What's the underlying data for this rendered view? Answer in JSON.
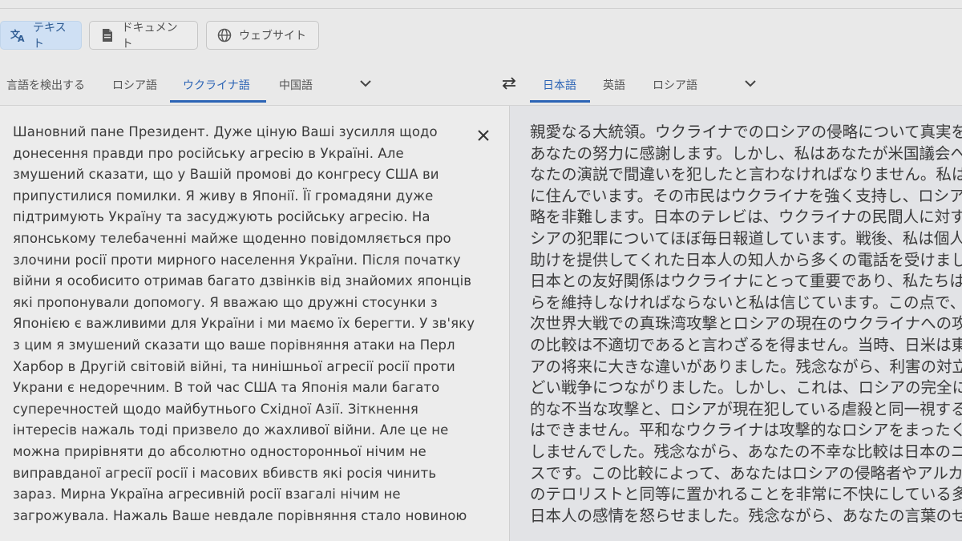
{
  "modes": [
    {
      "label": "テキスト",
      "icon": "translate-icon",
      "active": true
    },
    {
      "label": "ドキュメント",
      "icon": "document-icon",
      "active": false
    },
    {
      "label": "ウェブサイト",
      "icon": "globe-icon",
      "active": false
    }
  ],
  "source_langs": {
    "detect": "言語を検出する",
    "items": [
      "ロシア語",
      "ウクライナ語",
      "中国語"
    ],
    "active": "ウクライナ語"
  },
  "target_langs": {
    "items": [
      "日本語",
      "英語",
      "ロシア語"
    ],
    "active": "日本語"
  },
  "source_text": [
    "Шановний пане Президент. Дуже ціную Ваші зусилля щодо",
    "донесення правди про російську агресію в Україні. Але",
    "змушений сказати, що у Вашій промові до конгресу США ви",
    "припустилися помилки. Я живу в Японії. Її громадяни дуже",
    "підтримують Україну та засуджують російську агресію. На",
    "японському телебаченні майже щоденно повідомляється про",
    "злочини росії проти мирного населення України. Після початку",
    "війни я особисито отримав багато дзвінків від знайомих японців",
    "які пропонували допомогу. Я вважаю що дружні стосунки з",
    "Японією є важливими для України і ми маємо їх берегти. У зв'яку",
    "з цим я змушений сказати що ваше порівняння атаки на Перл",
    "Харбор в Другій світовій війні, та нинішньої агресії росії проти",
    "Украни є недоречним.  В той час США та Японія мали багато",
    "суперечностей щодо майбутнього Східної Азії. Зіткнення",
    "інтересів нажаль тоді призвело до жахливої війни. Але це не",
    "можна прирівняти до абсолютно односторонньої нічим не",
    "виправданої агресії росії і масових вбивств які росія чинить",
    "зараз. Мирна Україна агресивній росії взагалі нічим не",
    "загрожувала. Нажаль Ваше невдале порівняння стало новиною"
  ],
  "target_text": [
    "親愛なる大統領。ウクライナでのロシアの侵略について真実を語る",
    "あなたの努力に感謝します。しかし、私はあなたが米国議会へのあ",
    "なたの演説で間違いを犯したと言わなければなりません。私は日本",
    "に住んでいます。その市民はウクライナを強く支持し、ロシアの侵",
    "略を非難します。日本のテレビは、ウクライナの民間人に対するロ",
    "シアの犯罪についてほぼ毎日報道しています。戦後、私は個人的に",
    "助けを提供してくれた日本人の知人から多くの電話を受けました。",
    "日本との友好関係はウクライナにとって重要であり、私たちはそれ",
    "らを維持しなければならないと私は信じています。この点で、第二",
    "次世界大戦での真珠湾攻撃とロシアの現在のウクライナへの攻撃と",
    "の比較は不適切であると言わざるを得ません。当時、日米は東アジ",
    "アの将来に大きな違いがありました。残念ながら、利害の対立はひ",
    "どい戦争につながりました。しかし、これは、ロシアの完全に一方",
    "的な不当な攻撃と、ロシアが現在犯している虐殺と同一視すること",
    "はできません。平和なウクライナは攻撃的なロシアをまったく脅か",
    "しませんでした。残念ながら、あなたの不幸な比較は日本のニュー",
    "スです。この比較によって、あなたはロシアの侵略者やアルカイダ",
    "のテロリストと同等に置かれることを非常に不快にしている多くの",
    "日本人の感情を怒らせました。残念ながら、あなたの言葉のせい"
  ],
  "colors": {
    "accent": "#2c64b5",
    "active_tab_bg": "#cfe0f4"
  }
}
